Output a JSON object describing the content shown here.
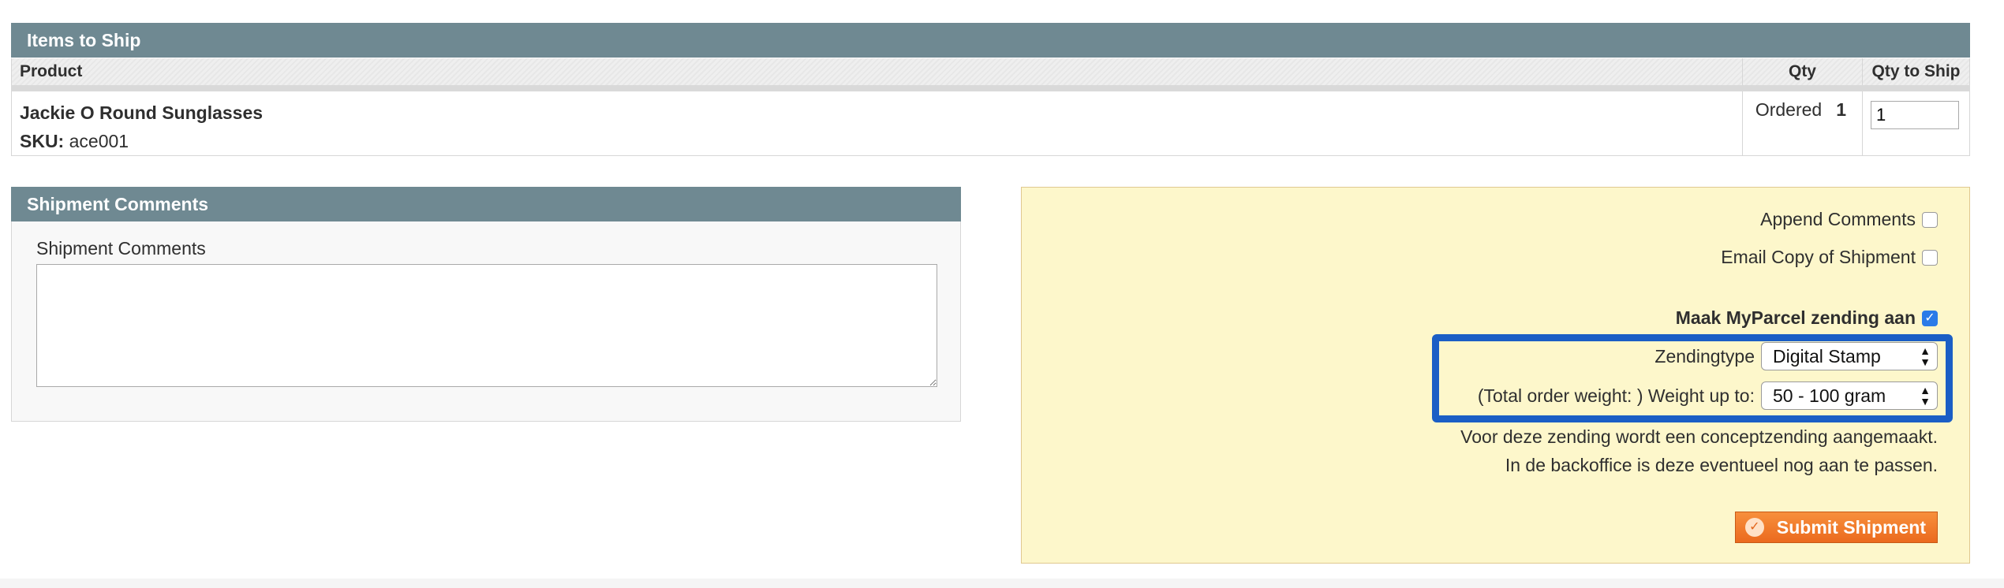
{
  "items": {
    "section_title": "Items to Ship",
    "columns": {
      "product": "Product",
      "qty": "Qty",
      "qty_to_ship": "Qty to Ship"
    },
    "rows": [
      {
        "name": "Jackie O Round Sunglasses",
        "sku_label": "SKU:",
        "sku": "ace001",
        "ordered_label": "Ordered",
        "ordered_qty": "1",
        "qty_to_ship": "1"
      }
    ]
  },
  "comments": {
    "section_title": "Shipment Comments",
    "label": "Shipment Comments",
    "value": ""
  },
  "options": {
    "append_comments_label": "Append Comments",
    "append_comments_checked": false,
    "email_copy_label": "Email Copy of Shipment",
    "email_copy_checked": false,
    "myparcel_label": "Maak MyParcel zending aan",
    "myparcel_checked": true,
    "checkmark": "✓",
    "zendingtype_label": "Zendingtype",
    "zendingtype_value": "Digital Stamp",
    "weight_label": "(Total order weight: ) Weight up to:",
    "weight_value": "50 - 100 gram",
    "note_line1": "Voor deze zending wordt een conceptzending aangemaakt.",
    "note_line2": "In de backoffice is deze eventueel nog aan te passen.",
    "submit_label": "Submit Shipment",
    "submit_icon_glyph": "✓",
    "select_arrows_up": "▲",
    "select_arrows_down": "▼",
    "highlight_color": "#1b5ec5",
    "submit_color": "#eb6a1e"
  }
}
